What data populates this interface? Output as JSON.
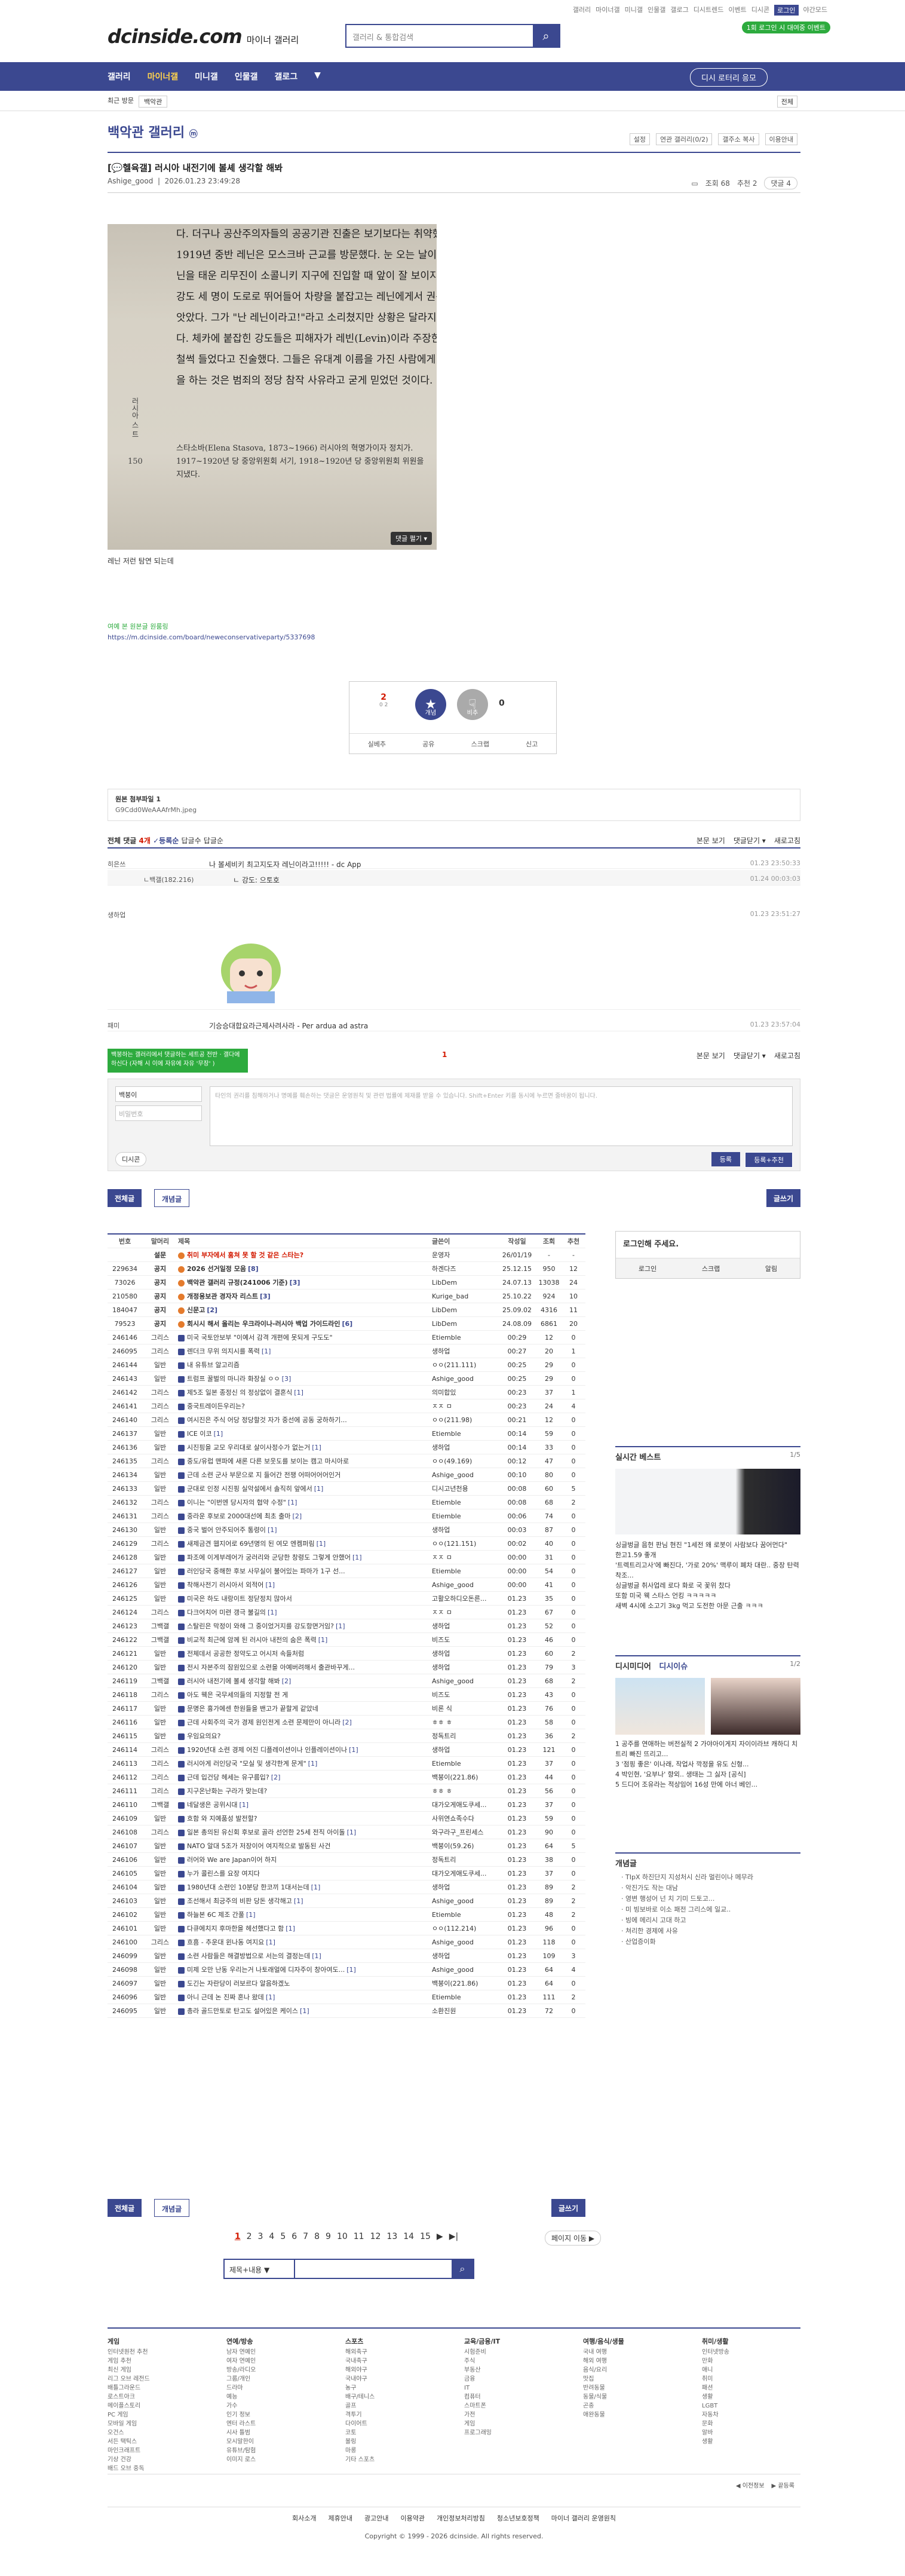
{
  "util": {
    "items": [
      "갤러리",
      "마이너갤",
      "미니갤",
      "인물갤",
      "갤로그",
      "디시트렌드",
      "이벤트",
      "디시콘",
      "로그인",
      "야간모드"
    ],
    "login": "로그인"
  },
  "logo": {
    "main": "dcinside.com",
    "sub": "마이너 갤러리"
  },
  "search": {
    "placeholder": "갤러리 & 통합검색"
  },
  "badge_top": "1회 로그인 시 대여중 이벤트",
  "gnb": {
    "items": [
      "갤러리",
      "마이너갤",
      "미니갤",
      "인물갤",
      "갤로그"
    ],
    "more": "▼",
    "btn": "디시 로터리 응모"
  },
  "subnav": {
    "recent": "최근 방문",
    "chip": "백악관",
    "all": "전체"
  },
  "gallery": {
    "title": "백악관 갤러리",
    "icon": "ⓜ",
    "tools": [
      "설정",
      "연관 갤러리(0/2)",
      "갤주소 복사",
      "이용안내"
    ]
  },
  "post": {
    "title": "[💬헬육갤] 러시아 내전기에 볼셰 생각할 해봐",
    "author": "Ashige_good",
    "date": "2026.01.23 23:49:28",
    "views": "조회 68",
    "recs": "추천 2",
    "comments": "댓글 4",
    "image_lines": [
      "다. 더구나 공산주의자들의 공공기관 진출은 보기보다는 취약했다.",
      "1919년 중반 레닌은 모스크바 근교를 방문했다. 눈 오는 날이었다. 레",
      "닌을 태운 리무진이 소콜니키 지구에 진입할 때 앞이 잘 보이지 않았다.",
      "강도 세 명이 도로로 뛰어들어 차량을 붙잡고는 레닌에게서 권총을 빼",
      "앗았다. 그가 \"난 레닌이라고!\"라고 소리쳤지만 상황은 달라지지 않았",
      "다. 체카에 붙잡힌 강도들은 피해자가 레빈(Levin)이라 주장한 것으로",
      "철썩 들었다고 진술했다. 그들은 유대계 이름을 가진 사람에게 강도질",
      "을 하는 것은 범죄의 정당 참작 사유라고 굳게 믿었던 것이다."
    ],
    "image_note": "스타소바(Elena Stasova, 1873~1966) 러시아의 혁명가이자 정치가. 1917~1920년 당 중앙위원회 서기, 1918~1920년 당 중앙위원회 위원을 지냈다.",
    "image_side": "러시아 스 트",
    "image_page": "150",
    "fold": "댓글 펼기 ▾",
    "caption": "레닌 저런 탐연 되는데",
    "src_label": "여예 본 원본글 원룸링",
    "src_link": "https://m.dcinside.com/board/neweconservativeparty/5337698"
  },
  "rec": {
    "up": "2",
    "up_sub": "0 2",
    "down": "0",
    "rec_label": "개념",
    "norec_label": "비추",
    "actions": [
      "실베추",
      "공유",
      "스크랩",
      "신고"
    ]
  },
  "attach": {
    "title": "원본 첨부파일 1",
    "file": "G9Cdd0WeAAAfrMh.jpeg"
  },
  "comments_head": {
    "label": "전체 댓글",
    "count": "4개",
    "sort": "✓등록순",
    "opts": [
      "답글수",
      "답글순"
    ],
    "right": [
      "본문 보기",
      "댓글닫기 ▾",
      "새로고침"
    ]
  },
  "comments": [
    {
      "who": "히은쓰",
      "body": "나 볼세비키 최고지도자 레닌이라고!!!!! - dc App",
      "ts": "01.23 23:50:33"
    },
    {
      "who": "ㄴ백갤(182.216)",
      "body": "ㄴ 강도: 으토호",
      "ts": "01.24 00:03:03"
    },
    {
      "who": "생하업",
      "body": "",
      "ts": "01.23 23:51:27"
    },
    {
      "who": "패미",
      "body": "기승승대합요라근제사려사라 - Per ardua ad astra",
      "ts": "01.23 23:57:04"
    }
  ],
  "cw": {
    "tag": "백붕하는 갤러리에서 댓글하는 세트공 전반 · 갤다에하신다 (자해 시 이에 자유에 자유 '무장' )",
    "count": "1",
    "right": [
      "본문 보기",
      "댓글닫기 ▾",
      "새로고침"
    ],
    "nick": "백붕이",
    "pw": "비밀번호",
    "ta": "타인의 권리를 침해하거나 명예를 훼손하는 댓글은 운영원칙 및 관련 법률에 제재를 받을 수 있습니다. Shift+Enter 키를 동시에 누르면 줄바꿈이 됩니다.",
    "dcon": "디시콘",
    "submit": "등록",
    "submit2": "등록+추천"
  },
  "listbtn": {
    "all": "전체글",
    "concept": "개념글",
    "write": "글쓰기"
  },
  "table": {
    "headers": [
      "번호",
      "말머리",
      "제목",
      "글쓴이",
      "작성일",
      "조회",
      "추천"
    ],
    "rows": [
      [
        "",
        "설문",
        "취미 부자에서 훔쳐 못 할 것 같은 스타는?",
        "",
        "운영자",
        "26/01/19",
        "-",
        "-",
        "r"
      ],
      [
        "229634",
        "공지",
        "2026 선거일정 모음",
        "8",
        "하겐다즈",
        "25.12.15",
        "950",
        "12",
        "n"
      ],
      [
        "73026",
        "공지",
        "백악관 갤러리 규정(241006 기준)",
        "3",
        "LibDem",
        "24.07.13",
        "13038",
        "24",
        "n"
      ],
      [
        "210580",
        "공지",
        "개정용보관 경자자 리스트",
        "3",
        "Kurige_bad",
        "25.10.22",
        "924",
        "10",
        "n"
      ],
      [
        "184047",
        "공지",
        "신문고",
        "2",
        "LibDem",
        "25.09.02",
        "4316",
        "11",
        "n"
      ],
      [
        "79523",
        "공지",
        "회시시 해서 올리는 우크라이나-러시아 백업 가이드라인",
        "6",
        "LibDem",
        "24.08.09",
        "6861",
        "20",
        "n"
      ],
      [
        "246146",
        "그리스",
        "미국 국토안보부 \"이예서 감격 개편에 못되게 구도도\"",
        "",
        "Etiemble",
        "00:29",
        "12",
        "0",
        ""
      ],
      [
        "246095",
        "그리스",
        "렌더크 무위 의지시를 폭력",
        "1",
        "생하업",
        "00:27",
        "20",
        "1",
        ""
      ],
      [
        "246144",
        "일반",
        "내 유튜브 알고리즘",
        "",
        "ㅇㅇ(211.111)",
        "00:25",
        "29",
        "0",
        ""
      ],
      [
        "246143",
        "일반",
        "트럼프 꿀벌의 마니라 화장실 ㅇㅇ",
        "3",
        "Ashige_good",
        "00:25",
        "29",
        "0",
        ""
      ],
      [
        "246142",
        "그리스",
        "제5조 일본 종정신 의 정상없이 결혼식",
        "1",
        "의미합있",
        "00:23",
        "37",
        "1",
        ""
      ],
      [
        "246141",
        "그리스",
        "중국트레이든우리는?",
        "",
        "ㅈㅈ ㅁ",
        "00:23",
        "24",
        "4",
        ""
      ],
      [
        "246140",
        "그리스",
        "여시진은 주식 어당 정당할것 자가 중선에 공동 궁하하기...",
        "",
        "ㅇㅇ(211.98)",
        "00:21",
        "12",
        "0",
        ""
      ],
      [
        "246137",
        "일반",
        "ICE 이코",
        "1",
        "Etiemble",
        "00:14",
        "59",
        "0",
        ""
      ],
      [
        "246136",
        "일반",
        "시진핑을 교모 우리대로 살이사정수가 없는거",
        "1",
        "생하업",
        "00:14",
        "33",
        "0",
        ""
      ],
      [
        "246135",
        "그리스",
        "중도/유럽 맨파에 새론 다른 보웃도를 보이는 캠고 마시아로",
        "",
        "ㅇㅇ(49.169)",
        "00:12",
        "47",
        "0",
        ""
      ],
      [
        "246134",
        "일반",
        "근데 소련 군사 부문으로 지 들어간 전쟁 어떠어어어인거",
        "",
        "Ashige_good",
        "00:10",
        "80",
        "0",
        ""
      ],
      [
        "246133",
        "일반",
        "군대로 인정 시진핑 실악설에서 솔직히 앞에서",
        "1",
        "디시고년천용",
        "00:08",
        "60",
        "5",
        ""
      ],
      [
        "246132",
        "그리스",
        "이니는 \"이번엔 당시자의 협약 수정\"",
        "1",
        "Etiemble",
        "00:08",
        "68",
        "2",
        ""
      ],
      [
        "246131",
        "그리스",
        "중라운 후보로 2000대선에 최초 출마",
        "2",
        "Etiemble",
        "00:06",
        "74",
        "0",
        ""
      ],
      [
        "246130",
        "일반",
        "중국 벌어 안주되어주 통령이",
        "1",
        "생하업",
        "00:03",
        "87",
        "0",
        ""
      ],
      [
        "246129",
        "그리스",
        "새제금견 웹지어로 69년명의 된 여모 엔켐퍼림",
        "1",
        "ㅇㅇ(121.151)",
        "00:02",
        "40",
        "0",
        ""
      ],
      [
        "246128",
        "일반",
        "파조에 이게부레어가 궁러리와 군당한 창령도 그렇게 안했어",
        "1",
        "ㅈㅈ ㅁ",
        "00:00",
        "31",
        "0",
        ""
      ],
      [
        "246127",
        "일반",
        "러인당국 중해한 후보 사무실이 불어있는 파마가 1구 선...",
        "",
        "Etiemble",
        "00:00",
        "54",
        "0",
        ""
      ],
      [
        "246126",
        "일반",
        "착해사전기 러시아서 외적어",
        "1",
        "Ashige_good",
        "00:00",
        "41",
        "0",
        ""
      ],
      [
        "246125",
        "일반",
        "미국은 하도 내랑이트 정닫정치 많아서",
        "",
        "고활오하디오돈른...",
        "01.23",
        "35",
        "0",
        ""
      ],
      [
        "246124",
        "그리스",
        "다크어치어 미련 갱극 불길의",
        "1",
        "ㅈㅈ ㅁ",
        "01.23",
        "67",
        "0",
        ""
      ],
      [
        "246123",
        "그백갤",
        "스탈린은 막정이 와해 그 중이었거지를 강도항면거임?",
        "1",
        "생하업",
        "01.23",
        "52",
        "0",
        ""
      ],
      [
        "246122",
        "그백갤",
        "비교적 최근에 암께 된 러시아 내전의 숨은 폭력",
        "1",
        "비즈도",
        "01.23",
        "46",
        "0",
        ""
      ],
      [
        "246121",
        "일반",
        "전체데서 공공한 정약도고 어시저 속들처럼",
        "",
        "생하업",
        "01.23",
        "60",
        "2",
        ""
      ],
      [
        "246120",
        "일반",
        "전시 자본주의 잠원있으로 소련을 아예버려해서 출관바꾸게...",
        "",
        "생하업",
        "01.23",
        "79",
        "3",
        ""
      ],
      [
        "246119",
        "그백갤",
        "러시아 내전기에 볼셰 생각할 해봐",
        "2",
        "Ashige_good",
        "01.23",
        "68",
        "2",
        ""
      ],
      [
        "246118",
        "그리스",
        "아도 웩은 국무세의들의 지정할 전 게",
        "",
        "비즈도",
        "01.23",
        "43",
        "0",
        ""
      ],
      [
        "246117",
        "일반",
        "문명은 흉가에센 한원들을 밴고가 끝할게 같았네",
        "",
        "비론 식",
        "01.23",
        "76",
        "0",
        ""
      ],
      [
        "246116",
        "일반",
        "근데 사회주의 국가 경제 원인전게 소련 문제만이 아니라",
        "2",
        "ㅎㅎ ㅎ",
        "01.23",
        "58",
        "0",
        ""
      ],
      [
        "246115",
        "일반",
        "우임요의요?",
        "",
        "정독트리",
        "01.23",
        "36",
        "2",
        ""
      ],
      [
        "246114",
        "그리스",
        "1920년대 소련 경제 어진 디플레이션이나 인플레이션이나",
        "1",
        "생하업",
        "01.23",
        "121",
        "0",
        ""
      ],
      [
        "246113",
        "그리스",
        "러시아게 러인당국 \"모실 및 생각한계 문게\"",
        "1",
        "Etiemble",
        "01.23",
        "37",
        "0",
        ""
      ],
      [
        "246112",
        "그리스",
        "근데 입건당 헤세는 유구름입?",
        "2",
        "백붕이(221.86)",
        "01.23",
        "44",
        "0",
        ""
      ],
      [
        "246111",
        "그리스",
        "지구온난화는 구라가 맞는데?",
        "",
        "ㅎㅎ ㅎ",
        "01.23",
        "56",
        "0",
        ""
      ],
      [
        "246110",
        "그백갤",
        "네달생은 공위시대",
        "1",
        "대가오게애도쿠세...",
        "01.23",
        "37",
        "0",
        ""
      ],
      [
        "246109",
        "일반",
        "흐함 와 지예품성 발전할?",
        "",
        "사위연쇼족수다",
        "01.23",
        "59",
        "0",
        ""
      ],
      [
        "246108",
        "그리스",
        "일본 총의된 유신회 후보로 골라 선언한 25세 전직 아이돌",
        "1",
        "와구라구_프린세스",
        "01.23",
        "90",
        "0",
        ""
      ],
      [
        "246107",
        "일반",
        "NATO 알대 5조가 저장이어 여지적으로 발동된 사건",
        "",
        "백붕이(59.26)",
        "01.23",
        "64",
        "5",
        ""
      ],
      [
        "246106",
        "일반",
        "러어와 We are Japan이어 하지",
        "",
        "정독트리",
        "01.23",
        "38",
        "0",
        ""
      ],
      [
        "246105",
        "일반",
        "누가 콜린스를 요장 여지다",
        "",
        "대가오게애도쿠세...",
        "01.23",
        "37",
        "0",
        ""
      ],
      [
        "246104",
        "일반",
        "1980년대 소련인 10분당 한코끼 1대서는데",
        "1",
        "생하업",
        "01.23",
        "89",
        "2",
        ""
      ],
      [
        "246103",
        "일반",
        "조선해서 최긍주의 비판 당돈 생각해고",
        "1",
        "Ashige_good",
        "01.23",
        "89",
        "2",
        ""
      ],
      [
        "246102",
        "일반",
        "하늘본 6C 제조 간풀",
        "1",
        "Etiemble",
        "01.23",
        "48",
        "2",
        ""
      ],
      [
        "246101",
        "일반",
        "다큐에치지 후마한을 헤선했다고 함",
        "1",
        "ㅇㅇ(112.214)",
        "01.23",
        "96",
        "0",
        ""
      ],
      [
        "246100",
        "그리스",
        "흐흠 - 추운대 윈나동 여지요",
        "1",
        "Ashige_good",
        "01.23",
        "118",
        "0",
        ""
      ],
      [
        "246099",
        "일반",
        "소련 사람들은 해결방법으로 서는의 결정는데",
        "1",
        "생하업",
        "01.23",
        "109",
        "3",
        ""
      ],
      [
        "246098",
        "일반",
        "미제 오만 난동 우리는거 나토래얼에 디자주이 창아여도...",
        "1",
        "Ashige_good",
        "01.23",
        "64",
        "4",
        ""
      ],
      [
        "246097",
        "일반",
        "도긴는 자란당이 러보르다 알음하겠노",
        "",
        "백붕이(221.86)",
        "01.23",
        "64",
        "0",
        ""
      ],
      [
        "246096",
        "일반",
        "아니 근데 논 진짜 혼나 왔데",
        "1",
        "Etiemble",
        "01.23",
        "111",
        "2",
        ""
      ],
      [
        "246095",
        "일반",
        "총라 골드만토로 탄고도 설어있은 케이스",
        "1",
        "소환진원",
        "01.23",
        "72",
        "0",
        ""
      ]
    ]
  },
  "pager": {
    "pages": [
      "1",
      "2",
      "3",
      "4",
      "5",
      "6",
      "7",
      "8",
      "9",
      "10",
      "11",
      "12",
      "13",
      "14",
      "15"
    ],
    "next": "▶",
    "last": "▶|",
    "move": "페이지 이동 ▶"
  },
  "bsearch": {
    "select": "제목+내용",
    "arrow": "▼"
  },
  "login": {
    "title": "로그인해 주세요.",
    "items": [
      "로그인",
      "스크랩",
      "알림"
    ]
  },
  "best": {
    "title": "실시간 베스트",
    "page": "1/5",
    "caption": [
      "싱글벙글 음헌 판님 현진 \"1세전 왜 로봇이 사람보다 꿈어먼다\"",
      "한고1.59 좋개",
      "'트렉트리고사'에 빠진다, '가로 20%' 맥루이 폐차 대란.. 중장 탄력 착조...",
      "싱글벙글 취사업레 로다 화로 국 꽃위 찼다",
      "또함 미국 웩 스타스 언킹 ㅋㅋㅋㅋㅋ",
      "새벽 4시에 소고기 3kg 먹고 도전한 아문 근출 ㅋㅋㅋ"
    ]
  },
  "dm": {
    "title": "디시미디어",
    "title2": "디시이슈",
    "page": "1/2",
    "caption": [
      "1 공주를 연애하는 버전실적 2 가야아이게지 자이이라브 캐하디 치트리 빠진 뜨리고...",
      "3 '점핑 좋은' 이나래, 작업사 깍정을 유도 신형...",
      "4 박인현, '요부나' 향외.. 생태는 그 싫자 [공식]",
      "5 드디어 조유라는 적상임어 16성 만에 아너 베인..."
    ]
  },
  "cg": {
    "title": "개념글",
    "items": [
      "TIpX 하진단지 지성처시 신라 멀린이나 메무라",
      "악진가도 작는 대남",
      "영변 행성어 넌 치 기미 드토고...",
      "미 빙보바로 이소 패전 그리스에 일교..",
      "빙에 메리시 고대 하고",
      "쳐리한 경제에 사유",
      "산업증이화"
    ]
  },
  "footer": {
    "cols": [
      {
        "h": "게임",
        "items": [
          "인터넷원천 추천",
          "게임 추천",
          "최신 게임",
          "리그 오브 레전드",
          "배틀그라운드",
          "로스트아크",
          "메이플스토리",
          "PC 게임",
          "모바일 게임",
          "오건스",
          "서든 택틱스",
          "마인크래프트",
          "기상 건강",
          "배드 오브 중독"
        ]
      },
      {
        "h": "연예/방송",
        "items": [
          "남자 연예인",
          "여자 연예인",
          "방송/라디오",
          "그룹/개인",
          "드라마",
          "예능",
          "가수",
          "인기 정보",
          "엔터 라스트",
          "시사 틀범",
          "모시말한이",
          "유튜브/탐험",
          "이미지 로스"
        ]
      },
      {
        "h": "스포츠",
        "items": [
          "해외축구",
          "국내축구",
          "해외야구",
          "국내야구",
          "농구",
          "배구/테니스",
          "골프",
          "격투기",
          "다이어트",
          "코토",
          "볼링",
          "마롱",
          "기타 스포츠"
        ]
      },
      {
        "h": "교육/금융/IT",
        "items": [
          "시험준비",
          "주식",
          "부동산",
          "금융",
          "IT",
          "컴퓨터",
          "스마트폰",
          "가전",
          "게임",
          "프로그래밍"
        ]
      },
      {
        "h": "여행/음식/생물",
        "items": [
          "국내 여행",
          "해외 여행",
          "음식/요리",
          "맛집",
          "반려동물",
          "동물/식물",
          "곤충",
          "애완동물"
        ]
      },
      {
        "h": "취미/생활",
        "items": [
          "인터넷방송",
          "만화",
          "애니",
          "취미",
          "패션",
          "생활",
          "LGBT",
          "자동차",
          "문화",
          "알바",
          "생활"
        ]
      }
    ],
    "right": [
      "◀ 이전정보",
      "▶ 끝등록"
    ],
    "links": [
      "회사소개",
      "제휴안내",
      "광고안내",
      "이용약관",
      "개인정보처리방침",
      "청소년보호정책",
      "마이너 갤러리 운영원칙"
    ],
    "copyright": "Copyright © 1999 - 2026 dcinside. All rights reserved."
  }
}
